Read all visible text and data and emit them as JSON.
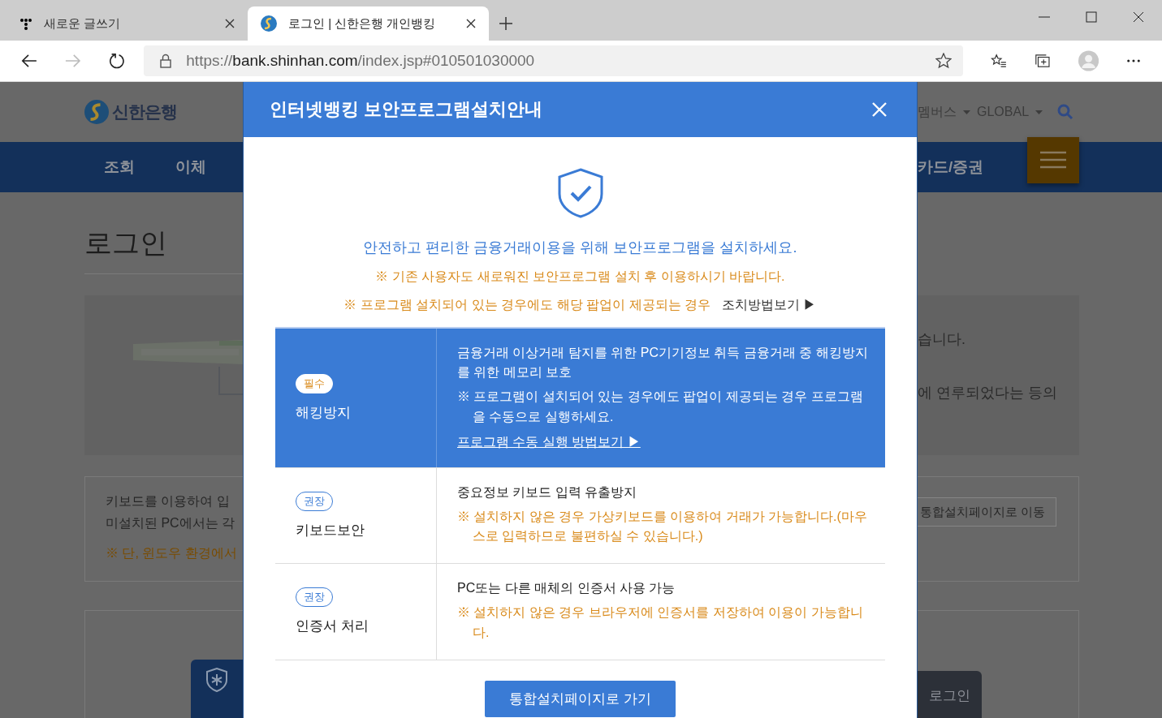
{
  "browser": {
    "tabs": [
      {
        "title": "새로운 글쓰기",
        "selected": false
      },
      {
        "title": "로그인 | 신한은행 개인뱅킹",
        "selected": true
      }
    ],
    "url": "https://**bank.shinhan.com**/index.jsp#010501030000"
  },
  "page": {
    "logo": "신한은행",
    "top_links": [
      "멤버스",
      "GLOBAL"
    ],
    "nav": [
      "조회",
      "이체"
    ],
    "nav_right": "카드/증권",
    "heading": "로그인",
    "notice_right": [
      "습니다.",
      "에 연루되었다는 등의"
    ],
    "keyboard_lines": [
      "키보드를 이용하여 입",
      "미설치된 PC에서는 각"
    ],
    "keyboard_warning": "※ 단, 윈도우 환경에서",
    "install_button": "통합설치페이지로 이동",
    "login_button": "로그인"
  },
  "modal": {
    "title": "인터넷뱅킹 보안프로그램설치안내",
    "intro": "안전하고 편리한 금융거래이용을 위해 보안프로그램을 설치하세요.",
    "notes": [
      "※ 기존 사용자도 새로워진 보안프로그램 설치 후 이용하시기 바랍니다.",
      "※ 프로그램 설치되어 있는 경우에도 해당 팝업이 제공되는 경우"
    ],
    "howto_link": "조치방법보기 ▶",
    "rows": [
      {
        "badge": "필수",
        "kind": "required",
        "name": "해킹방지",
        "highlighted": true,
        "lines": [
          {
            "kind": "plain",
            "text": "금융거래 이상거래 탐지를 위한 PC기기정보 취득 금융거래 중 해킹방지를 위한 메모리 보호"
          },
          {
            "kind": "note",
            "text": "※ 프로그램이 설치되어 있는 경우에도 팝업이 제공되는 경우 프로그램을 수동으로 실행하세요."
          },
          {
            "kind": "link",
            "text": "프로그램 수동 실행 방법보기 ▶"
          }
        ]
      },
      {
        "badge": "권장",
        "kind": "recommended",
        "name": "키보드보안",
        "highlighted": false,
        "lines": [
          {
            "kind": "plain",
            "text": "중요정보 키보드 입력 유출방지"
          },
          {
            "kind": "note",
            "text": "※ 설치하지 않은 경우 가상키보드를 이용하여 거래가 가능합니다.(마우스로 입력하므로 불편하실 수 있습니다.)"
          }
        ]
      },
      {
        "badge": "권장",
        "kind": "recommended",
        "name": "인증서 처리",
        "highlighted": false,
        "lines": [
          {
            "kind": "plain",
            "text": "PC또는 다른 매체의 인증서 사용 가능"
          },
          {
            "kind": "note",
            "text": "※ 설치하지 않은 경우 브라우저에 인증서를 저장하여 이용이 가능합니다."
          }
        ]
      }
    ],
    "button": "통합설치페이지로 가기"
  }
}
